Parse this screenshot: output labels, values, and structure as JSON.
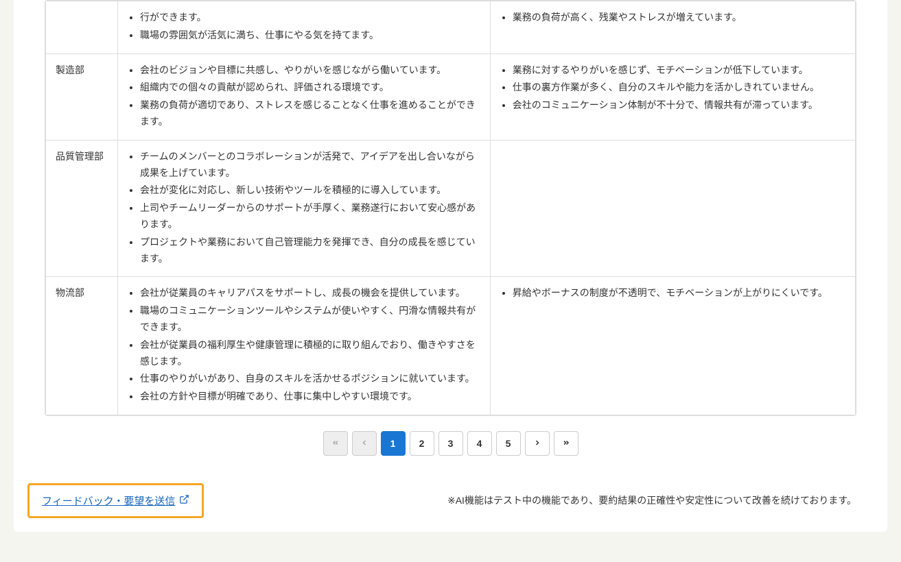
{
  "table": {
    "rows": [
      {
        "dept": "",
        "positive": [
          "行ができます。",
          "職場の雰囲気が活気に満ち、仕事にやる気を持てます。"
        ],
        "negative": [
          "業務の負荷が高く、残業やストレスが増えています。"
        ]
      },
      {
        "dept": "製造部",
        "positive": [
          "会社のビジョンや目標に共感し、やりがいを感じながら働いています。",
          "組織内での個々の貢献が認められ、評価される環境です。",
          "業務の負荷が適切であり、ストレスを感じることなく仕事を進めることができます。"
        ],
        "negative": [
          "業務に対するやりがいを感じず、モチベーションが低下しています。",
          "仕事の裏方作業が多く、自分のスキルや能力を活かしきれていません。",
          "会社のコミュニケーション体制が不十分で、情報共有が滞っています。"
        ]
      },
      {
        "dept": "品質管理部",
        "positive": [
          "チームのメンバーとのコラボレーションが活発で、アイデアを出し合いながら成果を上げています。",
          "会社が変化に対応し、新しい技術やツールを積極的に導入しています。",
          "上司やチームリーダーからのサポートが手厚く、業務遂行において安心感があります。",
          "プロジェクトや業務において自己管理能力を発揮でき、自分の成長を感じています。"
        ],
        "negative": []
      },
      {
        "dept": "物流部",
        "positive": [
          "会社が従業員のキャリアパスをサポートし、成長の機会を提供しています。",
          "職場のコミュニケーションツールやシステムが使いやすく、円滑な情報共有ができます。",
          "会社が従業員の福利厚生や健康管理に積極的に取り組んでおり、働きやすさを感じます。",
          "仕事のやりがいがあり、自身のスキルを活かせるポジションに就いています。",
          "会社の方針や目標が明確であり、仕事に集中しやすい環境です。"
        ],
        "negative": [
          "昇給やボーナスの制度が不透明で、モチベーションが上がりにくいです。"
        ]
      }
    ]
  },
  "pagination": {
    "pages": [
      "1",
      "2",
      "3",
      "4",
      "5"
    ],
    "active": "1"
  },
  "footer": {
    "feedback_label": "フィードバック・要望を送信",
    "ai_notice": "※AI機能はテスト中の機能であり、要約結果の正確性や安定性について改善を続けております。"
  }
}
